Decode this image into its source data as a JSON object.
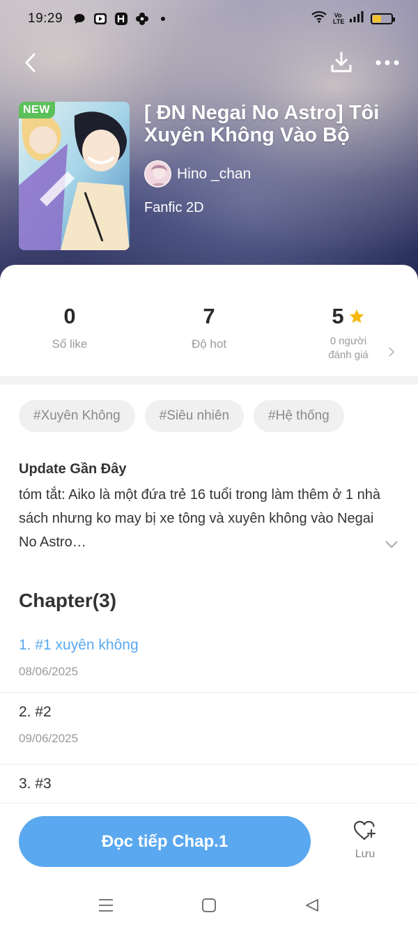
{
  "status_bar": {
    "time": "19:29",
    "left_icons": [
      "chat-bubble-icon",
      "video-app-icon",
      "h-app-icon",
      "flower-icon",
      "dot-icon"
    ],
    "right_icons": [
      "wifi-icon",
      "volte-icon",
      "signal-icon",
      "battery-icon"
    ],
    "volte_text": "Vo LTE",
    "battery_color": "#f4c430"
  },
  "nav": {
    "back_icon": "chevron-left-icon",
    "download_icon": "download-icon",
    "more_icon": "more-horizontal-icon"
  },
  "book": {
    "badge": "NEW",
    "title": "[ ĐN Negai No Astro] Tôi Xuyên Không Vào Bộ Truy…",
    "author": "Hino _chan",
    "genre": "Fanfic 2D"
  },
  "stats": {
    "likes_value": "0",
    "likes_label": "Số like",
    "hot_value": "7",
    "hot_label": "Độ hot",
    "rating_value": "5",
    "rating_label_line1": "0 người",
    "rating_label_line2": "đánh giá",
    "star_color": "#f6b90f"
  },
  "tags": [
    "#Xuyên Không",
    "#Siêu nhiên",
    "#Hệ thống"
  ],
  "summary": {
    "title": "Update Gần Đây",
    "text": "tóm tắt: Aiko là một đứa trẻ 16 tuổi trong làm thêm ở 1 nhà sách nhưng ko may bị xe tông và xuyên không vào Negai No Astro…"
  },
  "chapters": {
    "heading": "Chapter(3)",
    "items": [
      {
        "name": "1. #1 xuyên không",
        "date": "08/06/2025"
      },
      {
        "name": "2. #2",
        "date": "09/06/2025"
      },
      {
        "name": "3. #3",
        "date": ""
      }
    ]
  },
  "actions": {
    "read_label": "Đọc tiếp Chap.1",
    "save_label": "Lưu",
    "accent": "#5aa8ef"
  }
}
